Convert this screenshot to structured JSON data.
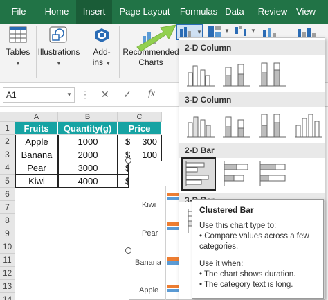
{
  "tabs": [
    "File",
    "Home",
    "Insert",
    "Page Layout",
    "Formulas",
    "Data",
    "Review",
    "View"
  ],
  "active_tab": "Insert",
  "ribbon": {
    "tables_label": "Tables",
    "illustrations_label": "Illustrations",
    "addins_label_1": "Add-",
    "addins_label_2": "ins",
    "recommended_label_1": "Recommended",
    "recommended_label_2": "Charts"
  },
  "formula_bar": {
    "name_box": "A1",
    "fx_label": "fx"
  },
  "columns": [
    "A",
    "B",
    "C"
  ],
  "rows": [
    "1",
    "2",
    "3",
    "4",
    "5",
    "6",
    "7",
    "8",
    "9",
    "10",
    "11",
    "12",
    "13",
    "14"
  ],
  "table": {
    "headers": [
      "Fruits",
      "Quantity(g)",
      "Price"
    ],
    "rows": [
      {
        "fruit": "Apple",
        "qty": "1000",
        "cur": "$",
        "price": "300"
      },
      {
        "fruit": "Banana",
        "qty": "2000",
        "cur": "$",
        "price": "100"
      },
      {
        "fruit": "Pear",
        "qty": "3000",
        "cur": "$",
        "price": ""
      },
      {
        "fruit": "Kiwi",
        "qty": "4000",
        "cur": "$",
        "price": ""
      }
    ]
  },
  "chart_preview": {
    "categories": [
      "Kiwi",
      "Pear",
      "Banana",
      "Apple"
    ],
    "colors": {
      "quantity": "#5b9bd5",
      "price": "#ed7d31"
    }
  },
  "gallery": {
    "sections": [
      "2-D Column",
      "3-D Column",
      "2-D Bar",
      "3-D Bar"
    ]
  },
  "tooltip": {
    "title": "Clustered Bar",
    "line1": "Use this chart type to:",
    "line2": "• Compare values across a few",
    "line3": "categories.",
    "line4": "Use it when:",
    "line5": "• The chart shows duration.",
    "line6": "• The category text is long."
  },
  "colors": {
    "excel_green": "#217346",
    "table_header": "#16a3a3",
    "arrow": "#92d050"
  }
}
